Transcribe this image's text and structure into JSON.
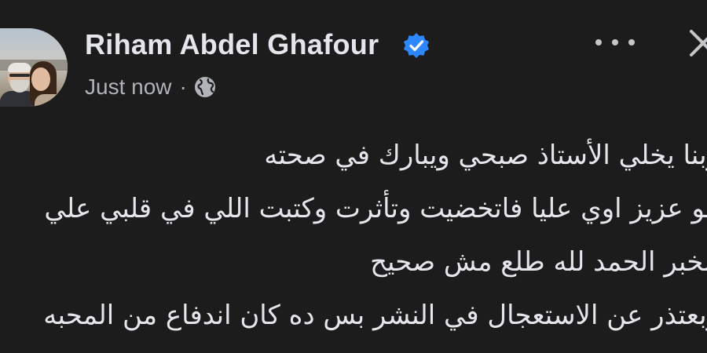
{
  "post": {
    "author": {
      "name": "Riham Abdel Ghafour",
      "verified": true,
      "avatar_description": "profile-photo"
    },
    "meta": {
      "time": "Just now",
      "separator": "·",
      "audience_icon": "globe-icon"
    },
    "actions": {
      "more_icon": "more-horizontal-icon",
      "close_icon": "close-icon"
    },
    "lines": [
      "ربنا يخلي الأستاذ صبحي ويبارك في صحته",
      "هو عزيز اوي عليا فاتخضيت وتأثرت وكتبت اللي في قلبي علي",
      "الخبر الحمد لله طلع مش صحيح",
      "وبعتذر عن الاستعجال في النشر بس ده كان اندفاع من المحبه"
    ]
  },
  "theme": {
    "background": "#1c1c1d",
    "text_primary": "#e4e6eb",
    "text_secondary": "#b0b3b8",
    "verified_badge": "#2d88ff"
  }
}
